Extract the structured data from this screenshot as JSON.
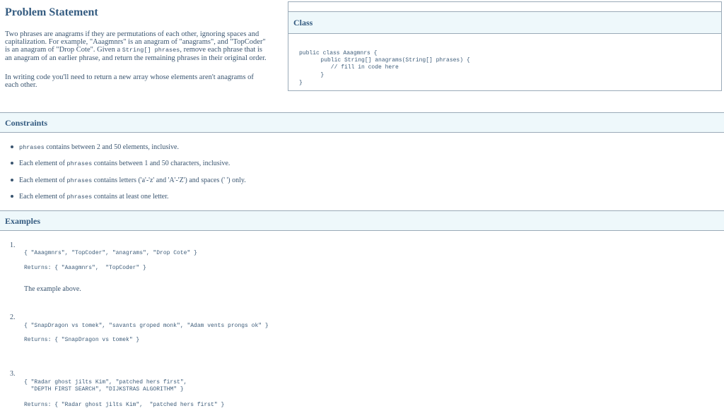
{
  "problem": {
    "title": "Problem Statement",
    "p1_a": "Two phrases are anagrams if they are permutations of each other, ignoring spaces and",
    "p1_b": "capitalization. For example, \"Aaagmnrs\" is an anagram of \"anagrams\", and \"TopCoder\"",
    "p1_c1": "is an anagram of \"Drop Cote\". Given a ",
    "p1_c_code": "String[] phrases",
    "p1_c2": ", remove each phrase that is",
    "p1_d": "an anagram of an earlier phrase, and return the remaining phrases in their original order.",
    "p2_a": "In writing code you'll need to return a new array whose elements aren't anagrams of",
    "p2_b": "each other."
  },
  "class_box": {
    "title": "Class",
    "code_lines": [
      "public class Aaagmnrs {",
      "   public String[] anagrams(String[] phrases) {",
      "      // fill in code here",
      "   }",
      "}"
    ]
  },
  "constraints": {
    "title": "Constraints",
    "items": [
      {
        "code": "phrases",
        "text": " contains between 2 and 50 elements, inclusive."
      },
      {
        "pre": "Each element of ",
        "code": "phrases",
        "text": " contains between 1 and 50 characters, inclusive."
      },
      {
        "pre": "Each element of ",
        "code": "phrases",
        "text": " contains letters ('a'-'z' and 'A'-'Z') and spaces (' ') only."
      },
      {
        "pre": "Each element of ",
        "code": "phrases",
        "text": " contains at least one letter."
      }
    ]
  },
  "examples": {
    "title": "Examples",
    "items": [
      {
        "num": "1.",
        "input": "{ \"Aaagmnrs\", \"TopCoder\", \"anagrams\", \"Drop Cote\" }",
        "returns": "Returns: { \"Aaagmnrs\",  \"TopCoder\" }",
        "note": "The example above."
      },
      {
        "num": "2.",
        "input": "{ \"SnapDragon vs tomek\", \"savants groped monk\", \"Adam vents prongs ok\" }",
        "returns": "Returns: { \"SnapDragon vs tomek\" }"
      },
      {
        "num": "3.",
        "input_a": "{ \"Radar ghost jilts Kim\", \"patched hers first\",",
        "input_b": "  \"DEPTH FIRST SEARCH\", \"DIJKSTRAS ALGORITHM\" }",
        "returns": "Returns: { \"Radar ghost jilts Kim\",  \"patched hers first\" }"
      }
    ]
  }
}
